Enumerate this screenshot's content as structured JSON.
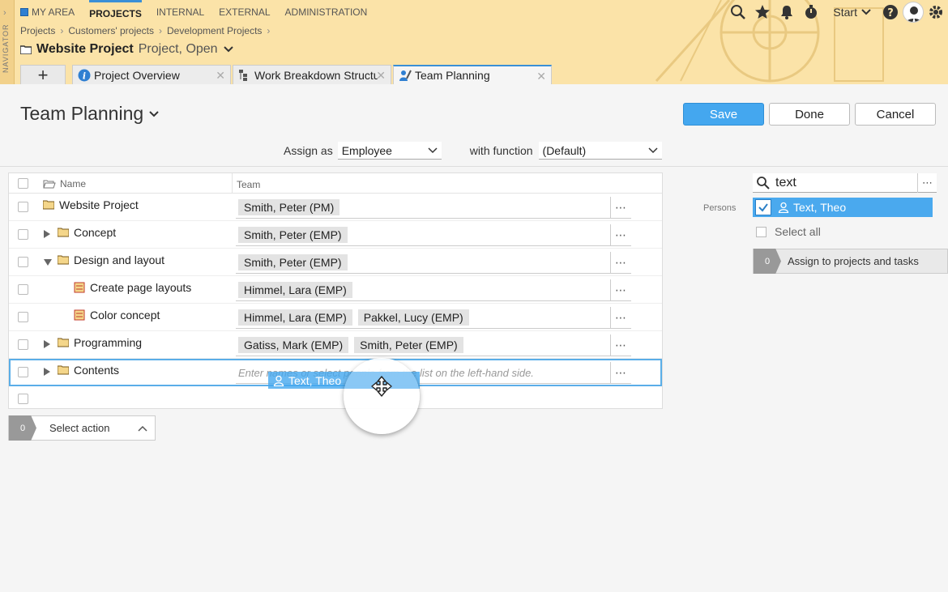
{
  "navigator": {
    "label": "NAVIGATOR"
  },
  "topnav": {
    "items": [
      "MY AREA",
      "PROJECTS",
      "INTERNAL",
      "EXTERNAL",
      "ADMINISTRATION"
    ],
    "active": "PROJECTS"
  },
  "toolbar": {
    "start_label": "Start"
  },
  "breadcrumb": [
    "Projects",
    "Customers' projects",
    "Development Projects"
  ],
  "project": {
    "name": "Website Project",
    "status": "Project, Open"
  },
  "tabs": [
    {
      "label": "Project Overview",
      "icon": "info-icon"
    },
    {
      "label": "Work Breakdown Structure",
      "icon": "wbs-icon"
    },
    {
      "label": "Team Planning",
      "icon": "team-icon"
    }
  ],
  "page": {
    "title": "Team Planning",
    "save": "Save",
    "done": "Done",
    "cancel": "Cancel",
    "assign_as_label": "Assign as",
    "assign_as_value": "Employee",
    "with_function_label": "with function",
    "with_function_value": "(Default)"
  },
  "table": {
    "col_name": "Name",
    "col_team": "Team",
    "rows": [
      {
        "name": "Website Project",
        "team": [
          "Smith, Peter (PM)"
        ]
      },
      {
        "name": "Concept",
        "team": [
          "Smith, Peter (EMP)"
        ]
      },
      {
        "name": "Design and layout",
        "team": [
          "Smith, Peter (EMP)"
        ]
      },
      {
        "name": "Create page layouts",
        "team": [
          "Himmel, Lara (EMP)"
        ]
      },
      {
        "name": "Color concept",
        "team": [
          "Himmel, Lara (EMP)",
          "Pakkel, Lucy (EMP)"
        ]
      },
      {
        "name": "Programming",
        "team": [
          "Gatiss, Mark (EMP)",
          "Smith, Peter (EMP)"
        ]
      },
      {
        "name": "Contents",
        "team": [],
        "placeholder": "Enter names or select people from the list on the left-hand side."
      }
    ]
  },
  "action": {
    "count": "0",
    "label": "Select action"
  },
  "drag": {
    "label": "Text, Theo"
  },
  "panel": {
    "search_value": "text",
    "persons_label": "Persons",
    "person": "Text, Theo",
    "select_all": "Select all",
    "assign_count": "0",
    "assign_label": "Assign to projects and tasks"
  },
  "colors": {
    "accent": "#44a7ef",
    "header": "#fbe3a8",
    "tab_active": "#3a8fd6"
  }
}
